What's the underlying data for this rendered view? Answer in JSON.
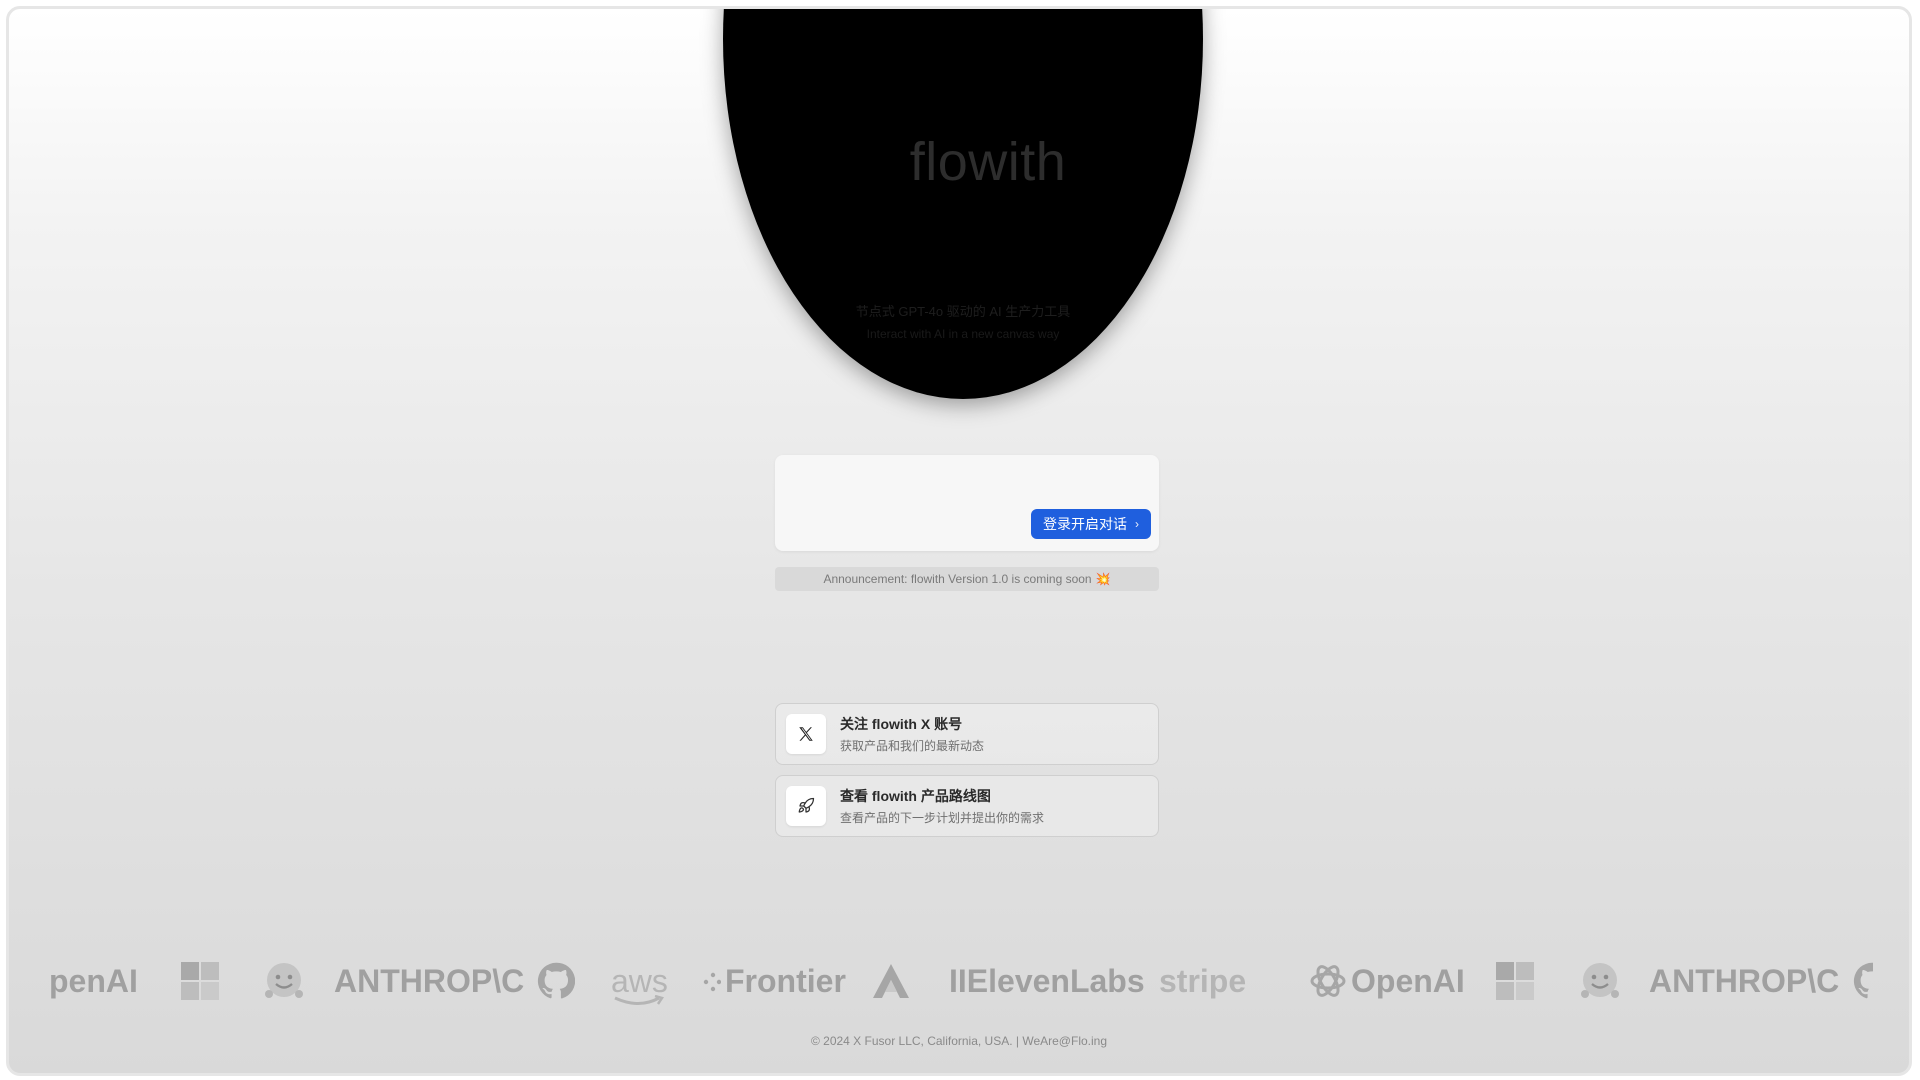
{
  "hero": {
    "brand": "flowith",
    "tagline_cn": "节点式 GPT-4o 驱动的 AI 生产力工具",
    "tagline_en": "Interact with AI in a new canvas way"
  },
  "chat": {
    "login_button_label": "登录开启对话",
    "chevron": "›"
  },
  "announcement": {
    "text": "Announcement: flowith Version 1.0 is coming soon",
    "emoji": "💥"
  },
  "cards": [
    {
      "title": "关注 flowith X 账号",
      "subtitle": "获取产品和我们的最新动态",
      "icon": "x-logo-icon"
    },
    {
      "title": "查看 flowith 产品路线图",
      "subtitle": "查看产品的下一步计划并提出你的需求",
      "icon": "rocket-icon"
    }
  ],
  "logos": {
    "openai_partial": "penAI",
    "anthropic": "ANTHROP\\C",
    "aws": "aws",
    "frontier": "Frontier",
    "elevenlabs": "IIElevenLabs",
    "stripe": "stripe",
    "openai": "OpenAI",
    "anthropic2": "ANTHROP\\C"
  },
  "footer": {
    "text": "© 2024 X Fusor LLC, California, USA. | WeAre@Flo.ing"
  }
}
